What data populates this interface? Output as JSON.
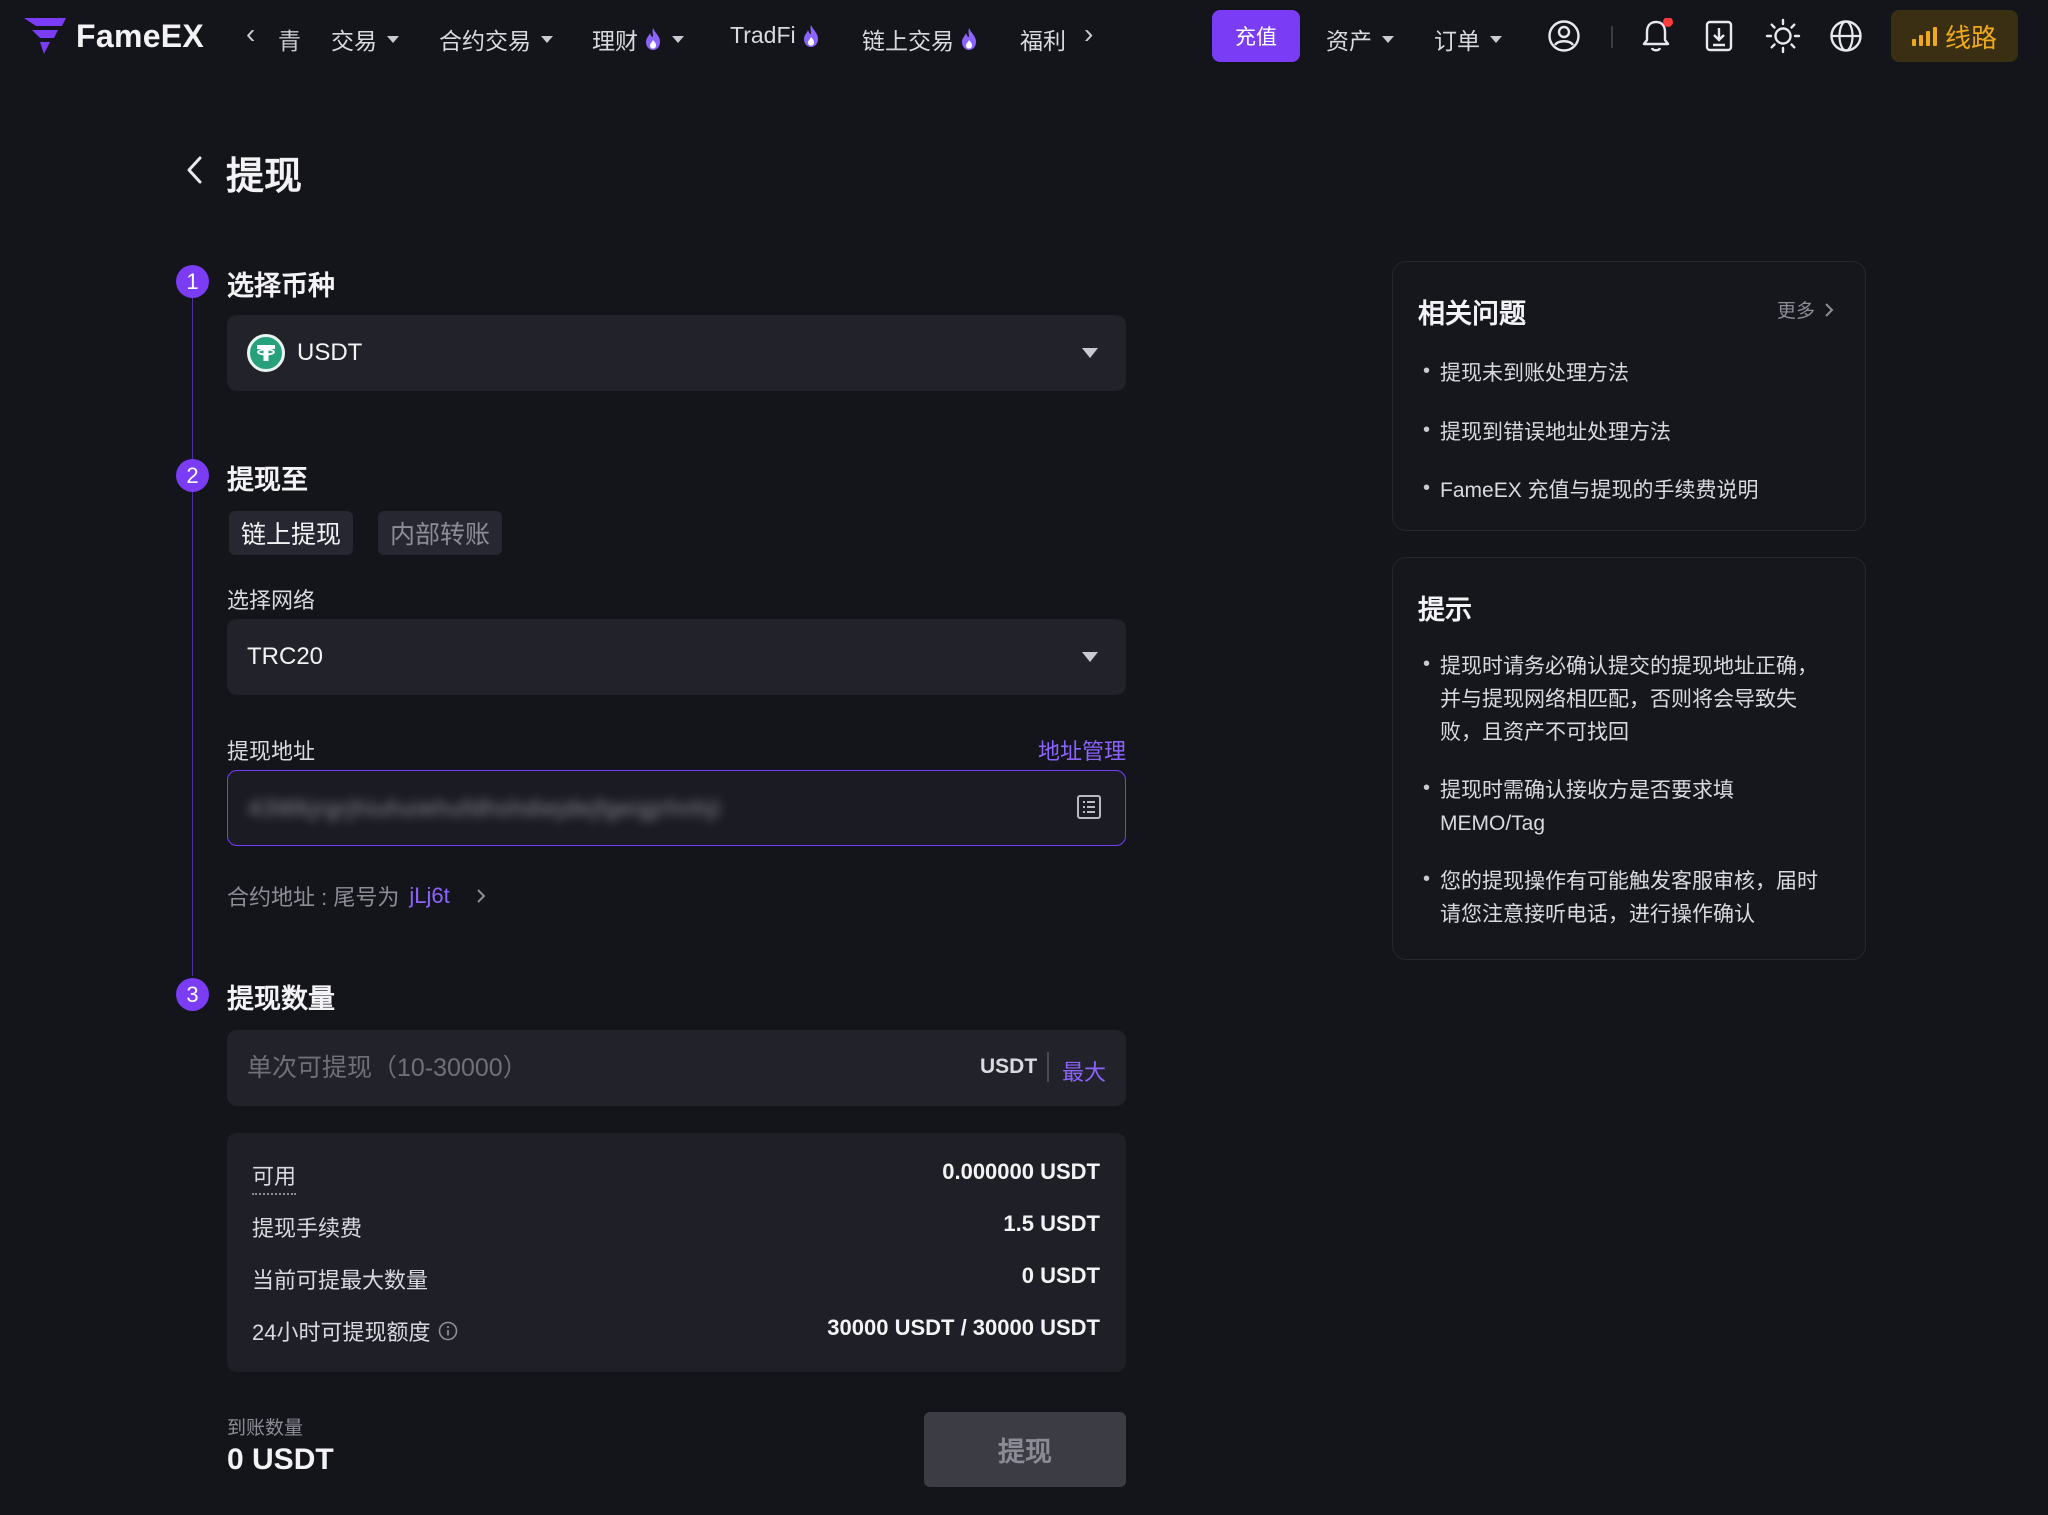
{
  "nav": {
    "logo_text": "FameEX",
    "partial_item": "青",
    "items": [
      {
        "label": "交易",
        "dropdown": true,
        "flame": false
      },
      {
        "label": "合约交易",
        "dropdown": true,
        "flame": false
      },
      {
        "label": "理财",
        "dropdown": true,
        "flame": true
      },
      {
        "label": "TradFi",
        "dropdown": false,
        "flame": true
      },
      {
        "label": "链上交易",
        "dropdown": false,
        "flame": true
      },
      {
        "label": "福利",
        "dropdown": false,
        "flame": false
      }
    ],
    "deposit_label": "充值",
    "assets_label": "资产",
    "orders_label": "订单",
    "line_label": "线路",
    "icons": [
      "user-icon",
      "bell-icon",
      "download-icon",
      "theme-sun-icon",
      "globe-icon"
    ],
    "accent": "#7b3cf6",
    "line_color": "#f0a91b"
  },
  "page": {
    "title": "提现"
  },
  "steps": {
    "step1": {
      "num": "1",
      "title": "选择币种"
    },
    "step2": {
      "num": "2",
      "title": "提现至"
    },
    "step3": {
      "num": "3",
      "title": "提现数量"
    }
  },
  "coin": {
    "selected": "USDT",
    "icon": "tether-icon",
    "color": "#26a17b"
  },
  "withdraw_to": {
    "tabs": [
      {
        "label": "链上提现",
        "active": true
      },
      {
        "label": "内部转账",
        "active": false
      }
    ],
    "network_label": "选择网络",
    "network_value": "TRC20",
    "address_label": "提现地址",
    "address_manage": "地址管理",
    "address_value": "43Wkjrgrjhiuhuiehufdhshdiejdejfgeigjrhnhji",
    "contract_prefix": "合约地址 : 尾号为",
    "contract_suffix": "jLj6t"
  },
  "amount": {
    "placeholder": "单次可提现（10-30000）",
    "unit": "USDT",
    "max_label": "最大"
  },
  "info": {
    "rows": [
      {
        "key": "可用",
        "value": "0.000000 USDT"
      },
      {
        "key": "提现手续费",
        "value": "1.5 USDT"
      },
      {
        "key": "当前可提最大数量",
        "value": "0 USDT"
      },
      {
        "key": "24小时可提现额度",
        "value": "30000 USDT / 30000 USDT"
      }
    ]
  },
  "arrival": {
    "label": "到账数量",
    "value": "0 USDT",
    "submit_label": "提现"
  },
  "faq": {
    "title": "相关问题",
    "more_label": "更多",
    "items": [
      "提现未到账处理方法",
      "提现到错误地址处理方法",
      "FameEX 充值与提现的手续费说明"
    ]
  },
  "tips": {
    "title": "提示",
    "items": [
      "提现时请务必确认提交的提现地址正确，并与提现网络相匹配，否则将会导致失败，且资产不可找回",
      "提现时需确认接收方是否要求填MEMO/Tag",
      "您的提现操作有可能触发客服审核，届时请您注意接听电话，进行操作确认"
    ]
  }
}
